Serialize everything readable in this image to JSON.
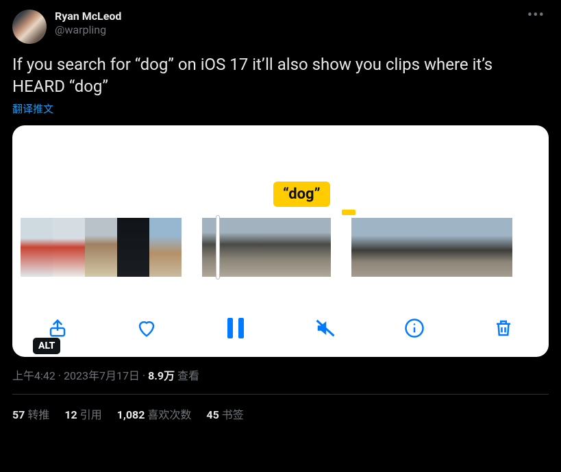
{
  "author": {
    "display_name": "Ryan McLeod",
    "handle": "@warpling"
  },
  "body": "If you search for “dog” on iOS 17 it’ll also show you clips where it’s HEARD “dog”",
  "translate_label": "翻译推文",
  "media": {
    "bubble_text": "“dog”",
    "alt_badge": "ALT",
    "toolbar": {
      "share": "Share",
      "like": "Like",
      "pause": "Pause",
      "mute": "Muted",
      "info": "Info",
      "trash": "Delete"
    }
  },
  "meta": {
    "time": "上午4:42",
    "dot1": " · ",
    "date": "2023年7月17日",
    "dot2": " · ",
    "views_value": "8.9万",
    "views_label": " 查看"
  },
  "stats": {
    "retweets": {
      "value": "57",
      "label": "转推"
    },
    "quotes": {
      "value": "12",
      "label": "引用"
    },
    "likes": {
      "value": "1,082",
      "label": "喜欢次数"
    },
    "bookmarks": {
      "value": "45",
      "label": "书签"
    }
  }
}
